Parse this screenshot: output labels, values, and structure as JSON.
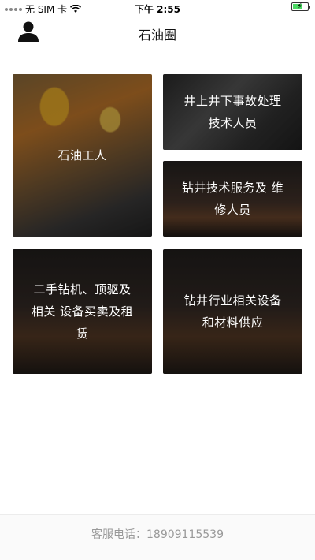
{
  "status_bar": {
    "carrier": "无 SIM 卡",
    "time": "下午 2:55",
    "icons": [
      "signal-dots",
      "wifi-icon",
      "battery-charging-icon"
    ]
  },
  "nav": {
    "title": "石油圈",
    "avatar_icon": "user-icon"
  },
  "tiles": [
    {
      "label": "石油工人"
    },
    {
      "label": "井上井下事故处理技术人员"
    },
    {
      "label": "钻井技术服务及 维修人员"
    },
    {
      "label": "二手钻机、顶驱及相关 设备买卖及租赁"
    },
    {
      "label": "钻井行业相关设备和材料供应"
    }
  ],
  "footer": {
    "service_phone": "客服电话：18909115539"
  }
}
